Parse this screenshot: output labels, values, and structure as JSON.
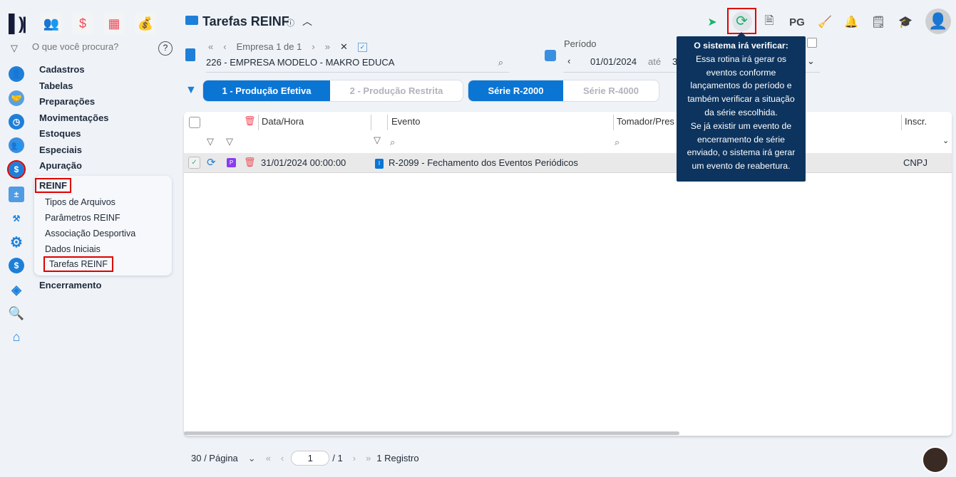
{
  "header": {
    "title": "Tarefas REINF",
    "pg_label": "PG"
  },
  "search": {
    "placeholder": "O que você procura?"
  },
  "menu": {
    "items": [
      "Cadastros",
      "Tabelas",
      "Preparações",
      "Movimentações",
      "Estoques",
      "Especiais",
      "Apuração"
    ],
    "group": "REINF",
    "subitems": [
      "Tipos de Arquivos",
      "Parâmetros REINF",
      "Associação Desportiva",
      "Dados Iniciais",
      "Tarefas REINF"
    ],
    "last": "Encerramento"
  },
  "empresa": {
    "nav": "Empresa 1 de 1",
    "value": "226 - EMPRESA MODELO - MAKRO EDUCA"
  },
  "periodo": {
    "label": "Período",
    "from": "01/01/2024",
    "ate": "até",
    "to": "3"
  },
  "tabs": {
    "prod1": "1 - Produção Efetiva",
    "prod2": "2 - Produção Restrita",
    "s2000": "Série R-2000",
    "s4000": "Série R-4000"
  },
  "table": {
    "headers": {
      "data": "Data/Hora",
      "evento": "Evento",
      "tomador": "Tomador/Pres",
      "inscr": "Inscr."
    },
    "rows": [
      {
        "badge": "P",
        "data": "31/01/2024 00:00:00",
        "tipo": "I",
        "evento": "R-2099 - Fechamento dos Eventos Periódicos",
        "inscr": "CNPJ"
      }
    ]
  },
  "tooltip": {
    "title": "O sistema irá verificar:",
    "lines": [
      "Essa rotina irá gerar os",
      "eventos conforme",
      "lançamentos do período e",
      "também verificar a situação",
      "da série escolhida.",
      "Se já existir um evento de",
      "encerramento de série",
      "enviado, o sistema irá gerar",
      "um evento de reabertura."
    ]
  },
  "pager": {
    "per_page": "30 / Página",
    "page": "1",
    "total": "/ 1",
    "records": "1 Registro"
  },
  "colors": {
    "accent": "#0b75d4",
    "tooltip": "#0d345e",
    "highlight": "#e00000"
  }
}
